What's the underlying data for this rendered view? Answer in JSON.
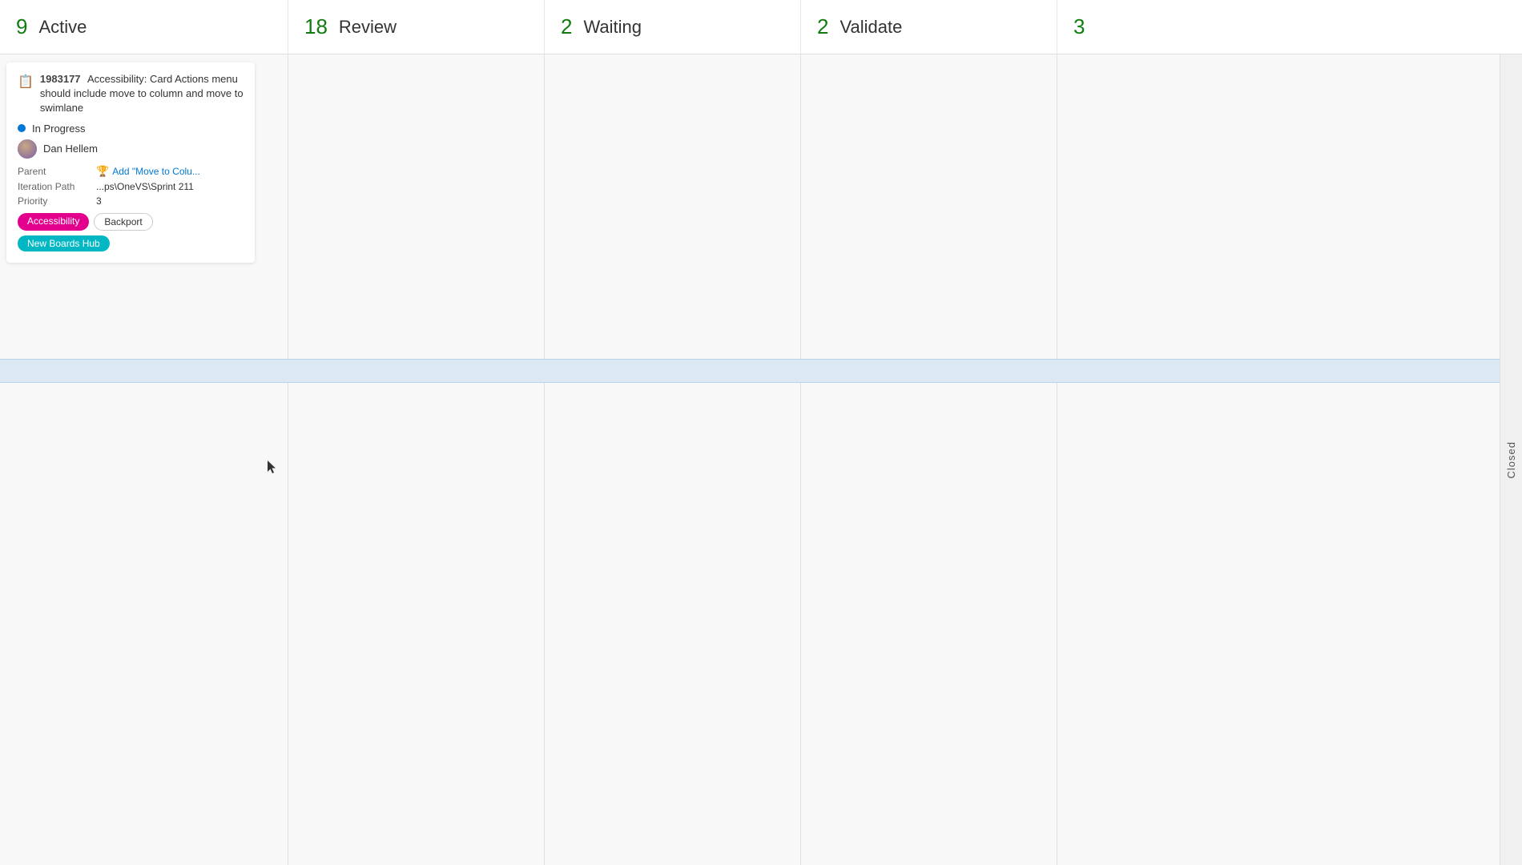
{
  "columns": [
    {
      "id": "active",
      "count": "9",
      "title": "Active"
    },
    {
      "id": "review",
      "count": "18",
      "title": "Review"
    },
    {
      "id": "waiting",
      "count": "2",
      "title": "Waiting"
    },
    {
      "id": "validate",
      "count": "2",
      "title": "Validate"
    },
    {
      "id": "extra",
      "count": "3",
      "title": ""
    }
  ],
  "nav_arrow": "›",
  "closed_label": "Closed",
  "card": {
    "icon": "📋",
    "id": "1983177",
    "title": "Accessibility: Card Actions menu should include move to column and move to swimlane",
    "status_dot_color": "#0078d4",
    "status": "In Progress",
    "assignee": "Dan Hellem",
    "parent_label": "Parent",
    "parent_value": "Add \"Move to Colu...",
    "iteration_label": "Iteration Path",
    "iteration_value": "...ps\\OneVS\\Sprint 211",
    "priority_label": "Priority",
    "priority_value": "3",
    "tags": [
      {
        "id": "accessibility",
        "label": "Accessibility",
        "class": "tag-accessibility"
      },
      {
        "id": "backport",
        "label": "Backport",
        "class": "tag-backport"
      },
      {
        "id": "new-boards-hub",
        "label": "New Boards Hub",
        "class": "tag-new-boards-hub"
      }
    ]
  }
}
